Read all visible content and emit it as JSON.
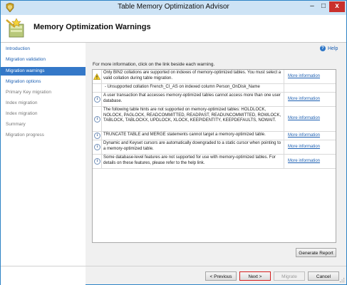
{
  "window": {
    "title": "Table Memory Optimization Advisor",
    "controls": {
      "minimize": "–",
      "maximize": "□",
      "close": "x"
    }
  },
  "header": {
    "title": "Memory Optimization Warnings"
  },
  "sidebar": {
    "items": [
      {
        "label": "Introduction",
        "state": "link"
      },
      {
        "label": "Migration validation",
        "state": "link"
      },
      {
        "label": "Migration warnings",
        "state": "active"
      },
      {
        "label": "Migration options",
        "state": "link"
      },
      {
        "label": "Primary Key migration",
        "state": "disabled"
      },
      {
        "label": "Index migration",
        "state": "disabled"
      },
      {
        "label": "Index migration",
        "state": "disabled"
      },
      {
        "label": "Summary",
        "state": "disabled"
      },
      {
        "label": "Migration progress",
        "state": "disabled"
      }
    ]
  },
  "help": {
    "label": "Help",
    "icon": "help-icon"
  },
  "main": {
    "info_text": "For more information, click on the link beside each warning.",
    "warnings": [
      {
        "icon": "warning-icon",
        "message": "Only BIN2 collations are supported on indexes of memory-optimized tables. You must select a valid collation during table migration.",
        "link": "More information"
      },
      {
        "icon": "",
        "message": "- Unsupported collation French_CI_AS on indexed column Person_OnDisk_Name",
        "link": ""
      },
      {
        "icon": "info-icon",
        "message": "A user transaction that accesses memory-optimized tables cannot access more than one user database.",
        "link": "More information"
      },
      {
        "icon": "info-icon",
        "message": "The following table hints are not supported on memory-optimized tables: HOLDLOCK, NOLOCK, PAGLOCK, READCOMMITTED, READPAST, READUNCOMMITTED, ROWLOCK, TABLOCK, TABLOCKX, UPDLOCK, XLOCK, KEEPIDENTITY, KEEPDEFAULTS, NOWAIT.",
        "link": "More information"
      },
      {
        "icon": "info-icon",
        "message": "TRUNCATE TABLE and MERGE statements cannot target a memory-optimized table.",
        "link": "More information"
      },
      {
        "icon": "info-icon",
        "message": "Dynamic and Keyset cursors are automatically downgraded to a static cursor when pointing to a memory-optimized table.",
        "link": "More information"
      },
      {
        "icon": "info-icon",
        "message": "Some database-level features are not supported for use with memory-optimized tables. For details on these features, please refer to the help link.",
        "link": "More information"
      }
    ],
    "generate_report": "Generate Report"
  },
  "footer": {
    "previous": "< Previous",
    "next": "Next >",
    "migrate": "Migrate",
    "cancel": "Cancel"
  },
  "colors": {
    "active_nav": "#3478c8",
    "link": "#1c5fb2",
    "close_button": "#c9302c",
    "titlebar": "#cde3f5",
    "next_border": "#d42020"
  }
}
